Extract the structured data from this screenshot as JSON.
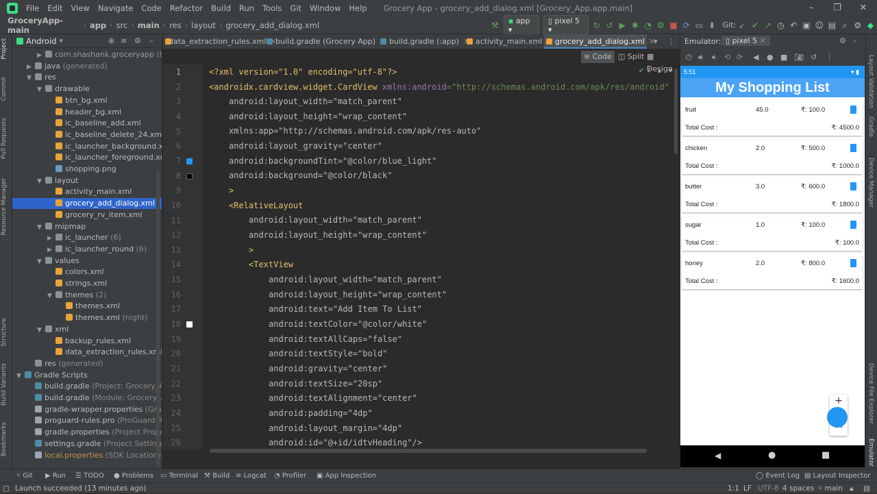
{
  "menu": {
    "items": [
      "File",
      "Edit",
      "View",
      "Navigate",
      "Code",
      "Refactor",
      "Build",
      "Run",
      "Tools",
      "Git",
      "Window",
      "Help"
    ],
    "window_title": "Grocery App - grocery_add_dialog.xml [Grocery_App.app.main]"
  },
  "breadcrumb": [
    "GroceryApp-main",
    "app",
    "src",
    "main",
    "res",
    "layout",
    "grocery_add_dialog.xml"
  ],
  "toolbar": {
    "run_config": "app",
    "device": "pixel 5",
    "git_label": "Git:"
  },
  "project": {
    "title": "Android",
    "tree": [
      {
        "label": "com.shashank.groceryapp",
        "extra": " (test)",
        "depth": 2,
        "arrow": "▶",
        "icon": "folder",
        "style": "gen"
      },
      {
        "label": "java",
        "extra": " (generated)",
        "depth": 1,
        "arrow": "▶",
        "icon": "folder"
      },
      {
        "label": "res",
        "extra": "",
        "depth": 1,
        "arrow": "▼",
        "icon": "folder"
      },
      {
        "label": "drawable",
        "extra": "",
        "depth": 2,
        "arrow": "▼",
        "icon": "folder"
      },
      {
        "label": "btn_bg.xml",
        "extra": "",
        "depth": 3,
        "arrow": "",
        "icon": "xml"
      },
      {
        "label": "header_bg.xml",
        "extra": "",
        "depth": 3,
        "arrow": "",
        "icon": "xml"
      },
      {
        "label": "ic_baseline_add.xml",
        "extra": "",
        "depth": 3,
        "arrow": "",
        "icon": "xml"
      },
      {
        "label": "ic_baseline_delete_24.xml",
        "extra": "",
        "depth": 3,
        "arrow": "",
        "icon": "xml"
      },
      {
        "label": "ic_launcher_background.xml",
        "extra": "",
        "depth": 3,
        "arrow": "",
        "icon": "xml"
      },
      {
        "label": "ic_launcher_foreground.xml",
        "extra": " (v",
        "depth": 3,
        "arrow": "",
        "icon": "xml"
      },
      {
        "label": "shopping.png",
        "extra": "",
        "depth": 3,
        "arrow": "",
        "icon": "png"
      },
      {
        "label": "layout",
        "extra": "",
        "depth": 2,
        "arrow": "▼",
        "icon": "folder"
      },
      {
        "label": "activity_main.xml",
        "extra": "",
        "depth": 3,
        "arrow": "",
        "icon": "xml"
      },
      {
        "label": "grocery_add_dialog.xml",
        "extra": "",
        "depth": 3,
        "arrow": "",
        "icon": "xml",
        "selected": true
      },
      {
        "label": "grocery_rv_item.xml",
        "extra": "",
        "depth": 3,
        "arrow": "",
        "icon": "xml"
      },
      {
        "label": "mipmap",
        "extra": "",
        "depth": 2,
        "arrow": "▼",
        "icon": "folder"
      },
      {
        "label": "ic_launcher",
        "extra": " (6)",
        "depth": 3,
        "arrow": "▶",
        "icon": "folder"
      },
      {
        "label": "ic_launcher_round",
        "extra": " (6)",
        "depth": 3,
        "arrow": "▶",
        "icon": "folder"
      },
      {
        "label": "values",
        "extra": "",
        "depth": 2,
        "arrow": "▼",
        "icon": "folder"
      },
      {
        "label": "colors.xml",
        "extra": "",
        "depth": 3,
        "arrow": "",
        "icon": "xml"
      },
      {
        "label": "strings.xml",
        "extra": "",
        "depth": 3,
        "arrow": "",
        "icon": "xml"
      },
      {
        "label": "themes",
        "extra": " (2)",
        "depth": 3,
        "arrow": "▼",
        "icon": "folder"
      },
      {
        "label": "themes.xml",
        "extra": "",
        "depth": 4,
        "arrow": "",
        "icon": "xml"
      },
      {
        "label": "themes.xml",
        "extra": " (night)",
        "depth": 4,
        "arrow": "",
        "icon": "xml"
      },
      {
        "label": "xml",
        "extra": "",
        "depth": 2,
        "arrow": "▼",
        "icon": "folder"
      },
      {
        "label": "backup_rules.xml",
        "extra": "",
        "depth": 3,
        "arrow": "",
        "icon": "xml"
      },
      {
        "label": "data_extraction_rules.xml",
        "extra": "",
        "depth": 3,
        "arrow": "",
        "icon": "xml"
      },
      {
        "label": "res",
        "extra": " (generated)",
        "depth": 1,
        "arrow": "",
        "icon": "folder"
      },
      {
        "label": "Gradle Scripts",
        "extra": "",
        "depth": 0,
        "arrow": "▼",
        "icon": "gradle"
      },
      {
        "label": "build.gradle",
        "extra": " (Project: Grocery_App)",
        "depth": 1,
        "arrow": "",
        "icon": "gradle"
      },
      {
        "label": "build.gradle",
        "extra": " (Module: Grocery_App.a",
        "depth": 1,
        "arrow": "",
        "icon": "gradle"
      },
      {
        "label": "gradle-wrapper.properties",
        "extra": " (Gradle V",
        "depth": 1,
        "arrow": "",
        "icon": "prop"
      },
      {
        "label": "proguard-rules.pro",
        "extra": " (ProGuard Rules",
        "depth": 1,
        "arrow": "",
        "icon": "prop"
      },
      {
        "label": "gradle.properties",
        "extra": " (Project Properties",
        "depth": 1,
        "arrow": "",
        "icon": "prop"
      },
      {
        "label": "settings.gradle",
        "extra": " (Project Settings)",
        "depth": 1,
        "arrow": "",
        "icon": "gradle"
      },
      {
        "label": "local.properties",
        "extra": " (SDK Location)",
        "depth": 1,
        "arrow": "",
        "icon": "prop",
        "style": "orange"
      }
    ]
  },
  "tabs": [
    "data_extraction_rules.xml",
    "build.gradle (Grocery App)",
    "build.gradle (:app)",
    "activity_main.xml",
    "grocery_add_dialog.xml"
  ],
  "view_modes": [
    "Code",
    "Split",
    "Design"
  ],
  "inspection_count": "7",
  "code": {
    "line_numbers": [
      "1",
      "2",
      "3",
      "4",
      "5",
      "6",
      "7",
      "8",
      "9",
      "10",
      "11",
      "12",
      "13",
      "14",
      "15",
      "16",
      "17",
      "18",
      "19",
      "20",
      "21",
      "22",
      "23",
      "24",
      "25",
      "26"
    ],
    "l1": "<?xml version=\"1.0\" encoding=\"utf-8\"?>",
    "l2_tag": "<androidx.cardview.widget.CardView ",
    "l2_ns": "xmlns:android",
    "l2_val": "=\"http://schemas.android.com/apk/res/android\"",
    "l3": "android:layout_width=\"match_parent\"",
    "l4": "android:layout_height=\"wrap_content\"",
    "l5": "xmlns:app=\"http://schemas.android.com/apk/res-auto\"",
    "l6": "android:layout_gravity=\"center\"",
    "l7": "android:backgroundTint=\"@color/blue_light\"",
    "l8": "android:background=\"@color/black\"",
    "l9": ">",
    "l10": "<RelativeLayout",
    "l11": "android:layout_width=\"match_parent\"",
    "l12": "android:layout_height=\"wrap_content\"",
    "l13": ">",
    "l14": "<TextView",
    "l15": "android:layout_width=\"match_parent\"",
    "l16": "android:layout_height=\"wrap_content\"",
    "l17": "android:text=\"Add Item To List\"",
    "l18": "android:textColor=\"@color/white\"",
    "l19": "android:textAllCaps=\"false\"",
    "l20": "android:textStyle=\"bold\"",
    "l21": "android:gravity=\"center\"",
    "l22": "android:textSize=\"20sp\"",
    "l23": "android:textAlignment=\"center\"",
    "l24": "android:padding=\"4dp\"",
    "l25": "android:layout_margin=\"4dp\"",
    "l26": "android:id=\"@+id/idtvHeading\"/>"
  },
  "emulator": {
    "label": "Emulator:",
    "device": "pixel 5",
    "time": "5:51",
    "app_title": "My Shopping List",
    "total_label": "Total Cost :",
    "items": [
      {
        "name": "fruit",
        "qty": "45.0",
        "price": "₹: 100.0",
        "total": "₹: 4500.0"
      },
      {
        "name": "chicken",
        "qty": "2.0",
        "price": "₹: 500.0",
        "total": "₹: 1000.0"
      },
      {
        "name": "butter",
        "qty": "3.0",
        "price": "₹: 600.0",
        "total": "₹: 1800.0"
      },
      {
        "name": "sugar",
        "qty": "1.0",
        "price": "₹: 100.0",
        "total": "₹: 100.0"
      },
      {
        "name": "honey",
        "qty": "2.0",
        "price": "₹: 800.0",
        "total": "₹: 1600.0"
      }
    ],
    "zoom_label": "1:1"
  },
  "left_tool_windows": [
    "Project",
    "Commit",
    "Pull Requests",
    "Resource Manager",
    "Structure",
    "Build Variants",
    "Bookmarks"
  ],
  "right_tool_windows": [
    "Layout Validation",
    "Gradle",
    "Device Manager",
    "Device File Explorer",
    "Emulator"
  ],
  "bottom_tools": [
    "Git",
    "Run",
    "TODO",
    "Problems",
    "Terminal",
    "Build",
    "Logcat",
    "Profiler",
    "App Inspection",
    "Event Log",
    "Layout Inspector"
  ],
  "status": {
    "message": "Launch succeeded (13 minutes ago)",
    "position": "1:1",
    "line_sep": "LF",
    "encoding": "UTF-8",
    "indent": "4 spaces",
    "branch": "main"
  },
  "colors": {
    "selection": "#2f65ca",
    "app_bar": "#4ba3f5",
    "status_bar": "#2196f3",
    "swatch_blue": "#2196f3",
    "swatch_black": "#000000",
    "swatch_white": "#ffffff"
  }
}
